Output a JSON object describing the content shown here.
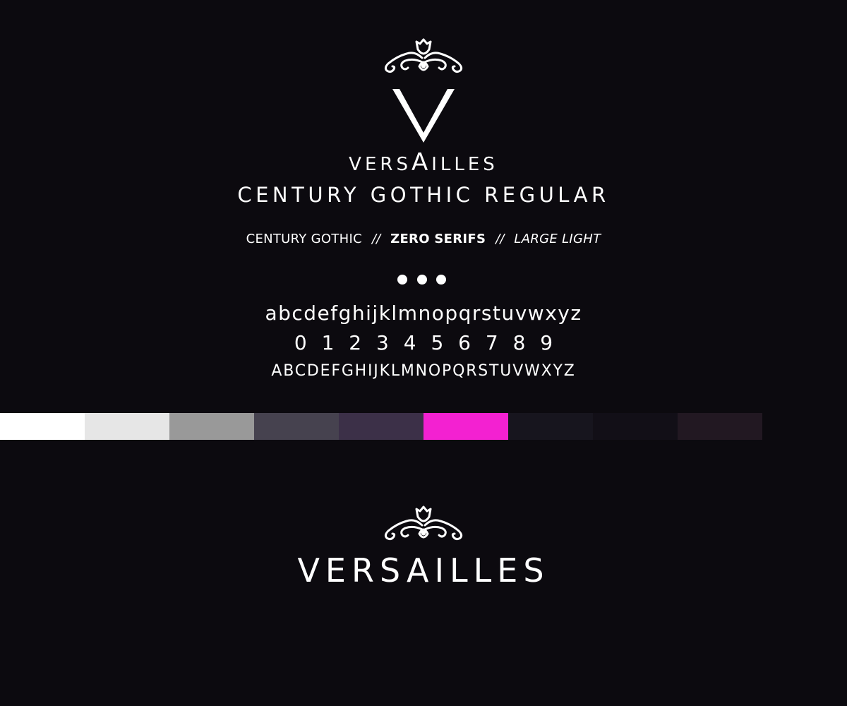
{
  "logo": {
    "word_pre": "VERS",
    "word_a": "A",
    "word_post": "ILLES",
    "monogram": "V"
  },
  "subtitle": "CENTURY GOTHIC REGULAR",
  "tagline": {
    "part1": "CENTURY GOTHIC",
    "sep1": "//",
    "part2": "ZERO SERIFS",
    "sep2": "//",
    "part3": "LARGE LIGHT"
  },
  "specimen": {
    "lowercase": "abcdefghijklmnopqrstuvwxyz",
    "digits": "0 1 2 3 4 5 6 7 8 9",
    "uppercase": "ABCDEFGHIJKLMNOPQRSTUVWXYZ"
  },
  "palette": [
    "#ffffff",
    "#e6e6e6",
    "#999999",
    "#46424f",
    "#3c3048",
    "#f321d1",
    "#17151e",
    "#120f17",
    "#221822"
  ],
  "footer": {
    "word": "VERSAILLES"
  },
  "colors": {
    "background": "#0c0a0f",
    "foreground": "#ffffff"
  },
  "icons": [
    "ornament-icon",
    "monogram-v-icon"
  ]
}
